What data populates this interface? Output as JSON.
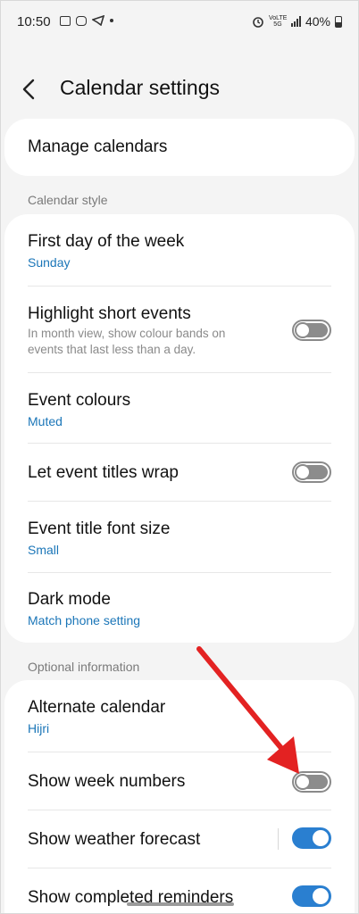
{
  "status_bar": {
    "time": "10:50",
    "battery": "40%",
    "network_tag": "VoLTE 5G"
  },
  "header": {
    "title": "Calendar settings"
  },
  "manage": {
    "label": "Manage calendars"
  },
  "calendar_style": {
    "section_title": "Calendar style",
    "first_day": {
      "label": "First day of the week",
      "value": "Sunday"
    },
    "highlight": {
      "label": "Highlight short events",
      "desc": "In month view, show colour bands on events that last less than a day.",
      "enabled": false
    },
    "event_colours": {
      "label": "Event colours",
      "value": "Muted"
    },
    "wrap_titles": {
      "label": "Let event titles wrap",
      "enabled": false
    },
    "font_size": {
      "label": "Event title font size",
      "value": "Small"
    },
    "dark_mode": {
      "label": "Dark mode",
      "value": "Match phone setting"
    }
  },
  "optional": {
    "section_title": "Optional information",
    "alternate": {
      "label": "Alternate calendar",
      "value": "Hijri"
    },
    "week_numbers": {
      "label": "Show week numbers",
      "enabled": false
    },
    "weather": {
      "label": "Show weather forecast",
      "enabled": true
    },
    "completed": {
      "label": "Show completed reminders",
      "enabled": true
    }
  },
  "colors": {
    "accent": "#2a7fd0",
    "link": "#1b76b8",
    "annotation_arrow": "#e32222"
  }
}
